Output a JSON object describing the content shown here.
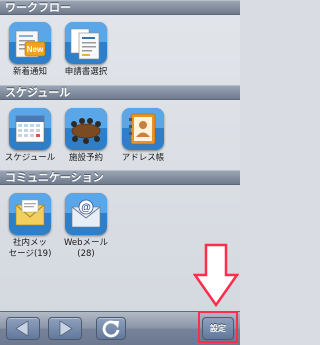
{
  "sections": [
    {
      "title": "ワークフロー",
      "apps": [
        {
          "label": "新着通知",
          "icon": "new-notification-icon"
        },
        {
          "label": "申請書選択",
          "icon": "application-form-icon"
        }
      ]
    },
    {
      "title": "スケジュール",
      "apps": [
        {
          "label": "スケジュール",
          "icon": "calendar-icon"
        },
        {
          "label": "施設予約",
          "icon": "meeting-room-icon"
        },
        {
          "label": "アドレス帳",
          "icon": "address-book-icon"
        }
      ]
    },
    {
      "title": "コミュニケーション",
      "apps": [
        {
          "label_line1": "社内メッ",
          "label_line2": "セージ(19)",
          "icon": "internal-message-icon"
        },
        {
          "label_line1": "Webメール",
          "label_line2": "(28)",
          "icon": "web-mail-icon"
        }
      ]
    }
  ],
  "toolbar": {
    "back_icon": "back-arrow-icon",
    "forward_icon": "forward-arrow-icon",
    "reload_icon": "reload-icon",
    "settings_label": "設定"
  },
  "annotation": {
    "arrow_color": "#ff2d4c",
    "arrow_icon": "down-arrow-icon"
  },
  "colors": {
    "header": "#7a8597",
    "toolbar": "#7f8aa0",
    "highlight": "#ff2d4c"
  }
}
